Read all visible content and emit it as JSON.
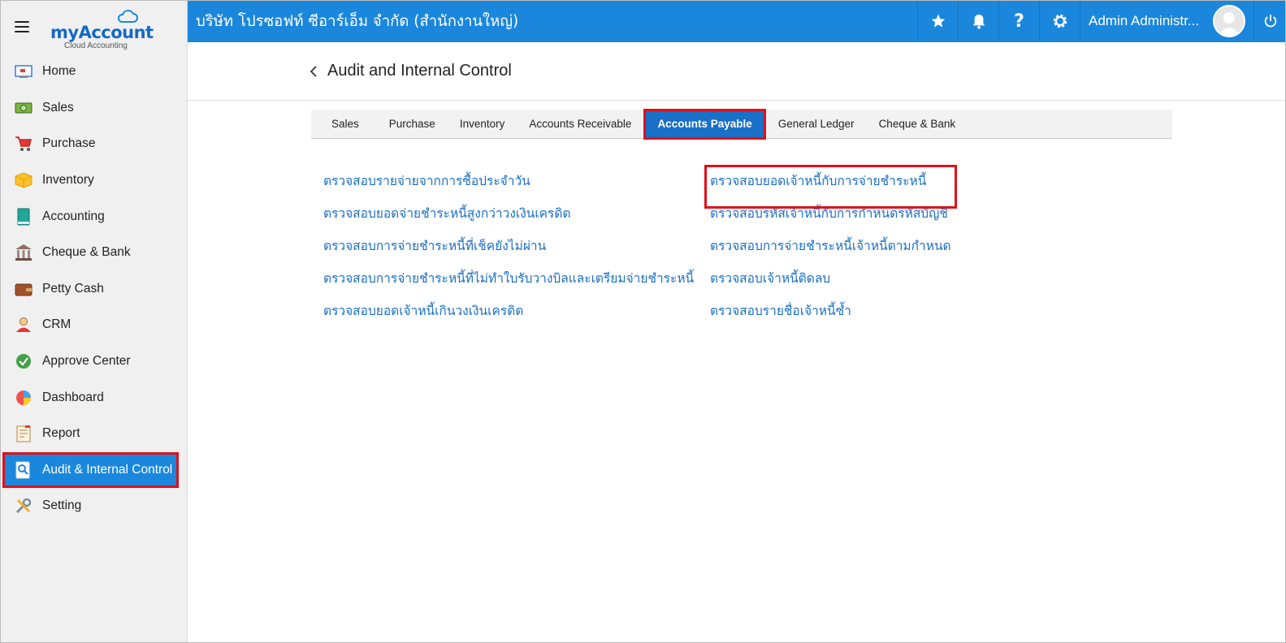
{
  "brand": {
    "name": "myAccount",
    "tagline": "Cloud Accounting"
  },
  "sidebar": {
    "items": [
      {
        "label": "Home",
        "icon": "home-icon"
      },
      {
        "label": "Sales",
        "icon": "money-icon"
      },
      {
        "label": "Purchase",
        "icon": "cart-icon"
      },
      {
        "label": "Inventory",
        "icon": "box-icon"
      },
      {
        "label": "Accounting",
        "icon": "book-icon"
      },
      {
        "label": "Cheque & Bank",
        "icon": "bank-icon"
      },
      {
        "label": "Petty Cash",
        "icon": "wallet-icon"
      },
      {
        "label": "CRM",
        "icon": "people-icon"
      },
      {
        "label": "Approve Center",
        "icon": "check-icon"
      },
      {
        "label": "Dashboard",
        "icon": "pie-chart-icon"
      },
      {
        "label": "Report",
        "icon": "report-icon"
      },
      {
        "label": "Audit & Internal Control",
        "icon": "audit-icon",
        "active": true
      },
      {
        "label": "Setting",
        "icon": "tools-icon"
      }
    ]
  },
  "topbar": {
    "company": "บริษัท โปรซอฟท์ ซีอาร์เอ็ม จำกัด (สำนักงานใหญ่)",
    "user": "Admin Administr...",
    "icons": [
      "star-icon",
      "bell-icon",
      "help-icon",
      "gear-icon",
      "power-icon"
    ]
  },
  "page": {
    "title": "Audit and Internal Control"
  },
  "tabs": [
    {
      "label": "Sales"
    },
    {
      "label": "Purchase"
    },
    {
      "label": "Inventory"
    },
    {
      "label": "Accounts Receivable"
    },
    {
      "label": "Accounts Payable",
      "active": true
    },
    {
      "label": "General Ledger"
    },
    {
      "label": "Cheque & Bank"
    }
  ],
  "links": {
    "left": [
      "ตรวจสอบรายจ่ายจากการซื้อประจำวัน",
      "ตรวจสอบยอดจ่ายชำระหนี้สูงกว่าวงเงินเครดิต",
      "ตรวจสอบการจ่ายชำระหนี้ที่เช็คยังไม่ผ่าน",
      "ตรวจสอบการจ่ายชำระหนี้ที่ไม่ทำใบรับวางบิลและเตรียมจ่ายชำระหนี้",
      "ตรวจสอบยอดเจ้าหนี้เกินวงเงินเครดิต"
    ],
    "right": [
      "ตรวจสอบยอดเจ้าหนี้กับการจ่ายชำระหนี้",
      "ตรวจสอบรหัสเจ้าหนี้กับการกำหนดรหัสบัญชี",
      "ตรวจสอบการจ่ายชำระหนี้เจ้าหนี้ตามกำหนด",
      "ตรวจสอบเจ้าหนี้ติดลบ",
      "ตรวจสอบรายชื่อเจ้าหนี้ซ้ำ"
    ]
  },
  "colors": {
    "primary": "#1a87dd",
    "link": "#1a6fc6",
    "highlight": "#e0101a"
  }
}
